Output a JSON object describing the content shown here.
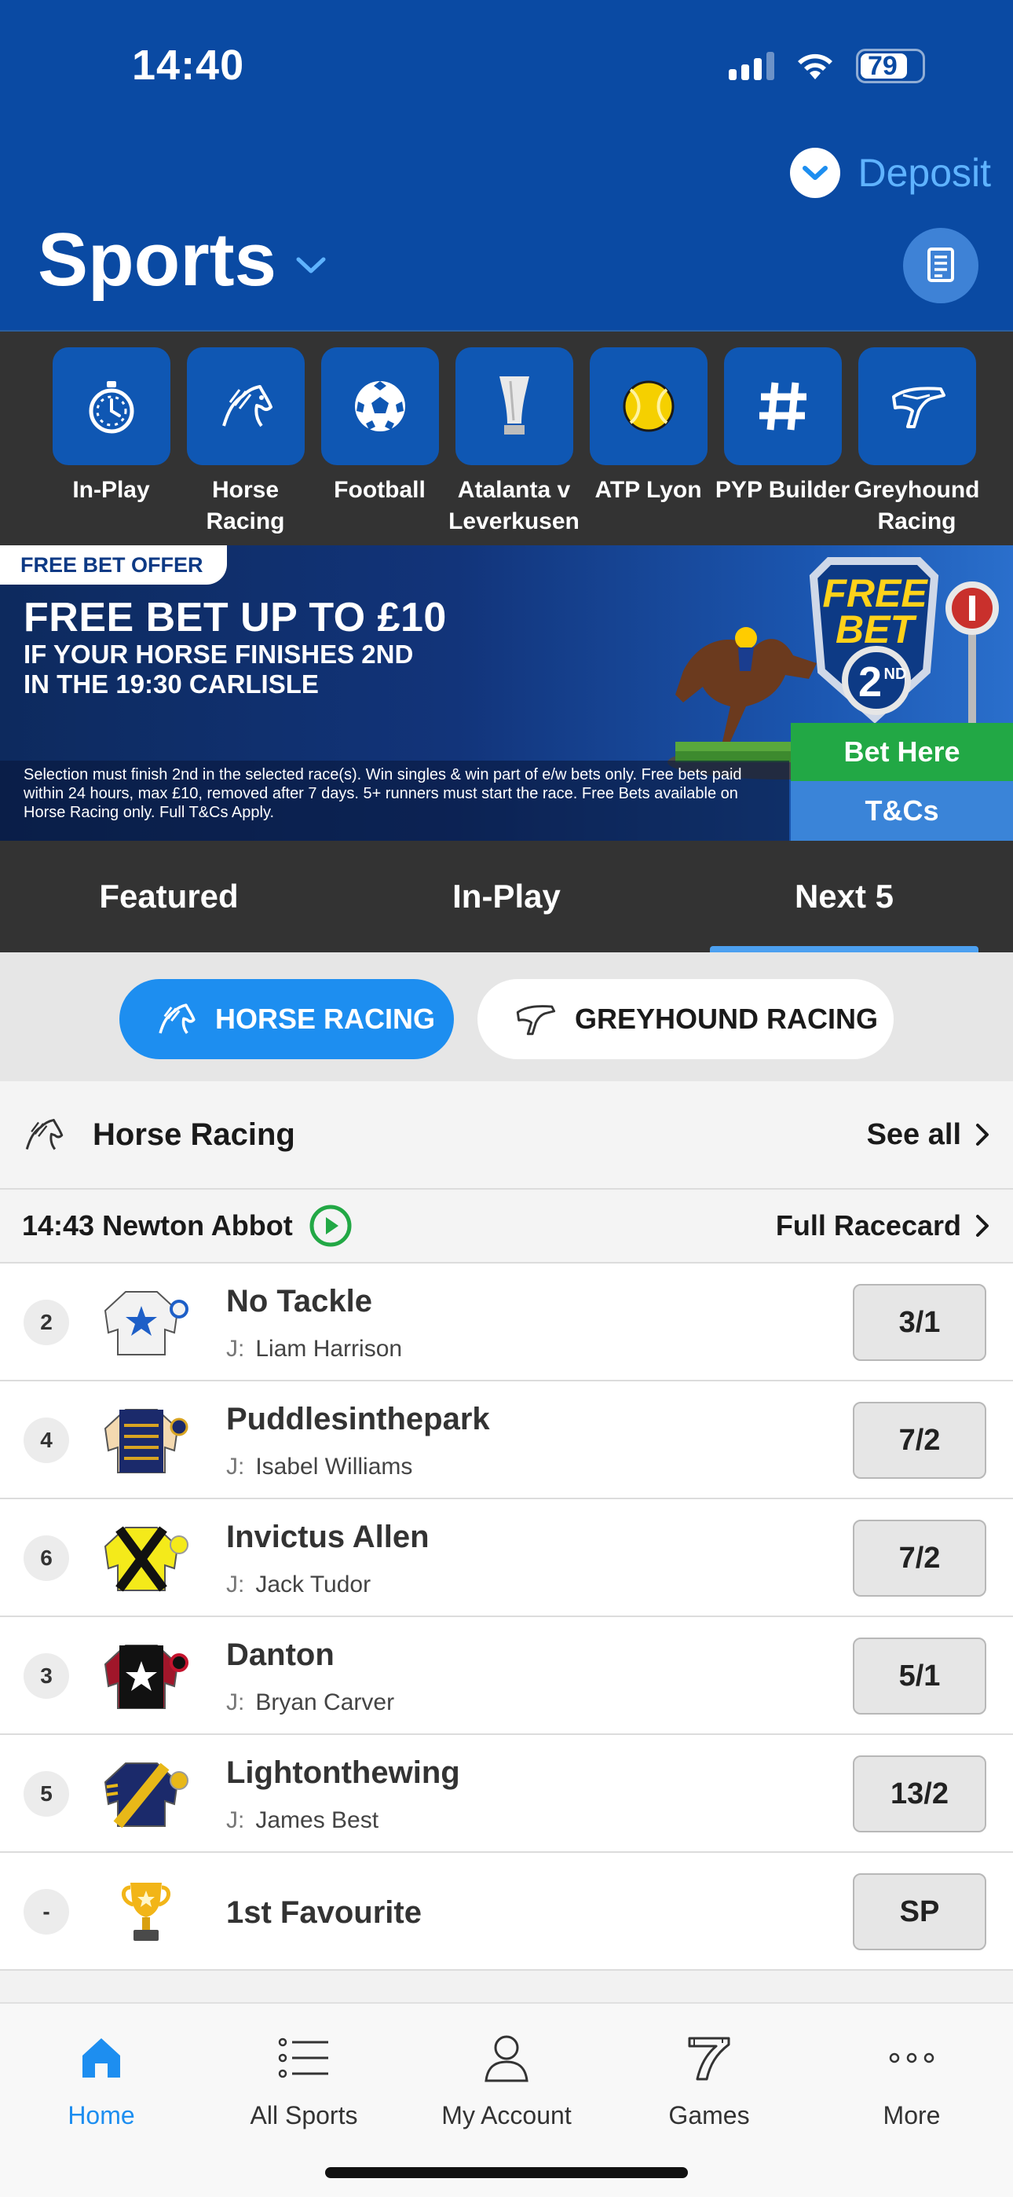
{
  "status_bar": {
    "time": "14:40",
    "battery": "79",
    "battery_level": 0.79
  },
  "header": {
    "deposit_label": "Deposit",
    "title": "Sports"
  },
  "quick_links": [
    {
      "label_1": "In-Play",
      "label_2": "",
      "icon": "stopwatch-icon"
    },
    {
      "label_1": "Horse",
      "label_2": "Racing",
      "icon": "horse-head-icon"
    },
    {
      "label_1": "Football",
      "label_2": "",
      "icon": "football-icon"
    },
    {
      "label_1": "Atalanta v",
      "label_2": "Leverkusen",
      "icon": "trophy-icon"
    },
    {
      "label_1": "ATP Lyon",
      "label_2": "",
      "icon": "tennis-ball-icon"
    },
    {
      "label_1": "PYP Builder",
      "label_2": "",
      "icon": "hash-icon"
    },
    {
      "label_1": "Greyhound",
      "label_2": "Racing",
      "icon": "greyhound-icon"
    }
  ],
  "promo": {
    "tag": "FREE BET OFFER",
    "headline": "FREE BET UP TO £10",
    "sub_line_1": "IF YOUR HORSE FINISHES 2ND",
    "sub_line_2": "IN THE 19:30 CARLISLE",
    "terms": "Selection must finish 2nd in the selected race(s). Win singles & win part of e/w bets only. Free bets paid within 24 hours, max £10, removed after 7 days. 5+ runners must start the race. Free Bets available on Horse Racing only. Full T&Cs Apply.",
    "badge_line_1": "FREE",
    "badge_line_2": "BET",
    "badge_place": "2",
    "badge_suffix": "ND",
    "bet_here_label": "Bet Here",
    "tcs_label": "T&Cs"
  },
  "tabs": [
    {
      "label": "Featured",
      "active": false
    },
    {
      "label": "In-Play",
      "active": false
    },
    {
      "label": "Next 5",
      "active": true
    }
  ],
  "sport_toggle": {
    "horse": "HORSE RACING",
    "greyhound": "GREYHOUND RACING"
  },
  "section": {
    "title": "Horse Racing",
    "see_all": "See all"
  },
  "race": {
    "title": "14:43 Newton Abbot",
    "racecard_label": "Full Racecard"
  },
  "runners": [
    {
      "num": "2",
      "name": "No Tackle",
      "jockey_label": "J:",
      "jockey": "Liam Harrison",
      "odds": "3/1",
      "silk": "white-blue-star"
    },
    {
      "num": "4",
      "name": "Puddlesinthepark",
      "jockey_label": "J:",
      "jockey": "Isabel Williams",
      "odds": "7/2",
      "silk": "navy-gold-braid"
    },
    {
      "num": "6",
      "name": "Invictus Allen",
      "jockey_label": "J:",
      "jockey": "Jack Tudor",
      "odds": "7/2",
      "silk": "yellow-black-cross"
    },
    {
      "num": "3",
      "name": "Danton",
      "jockey_label": "J:",
      "jockey": "Bryan Carver",
      "odds": "5/1",
      "silk": "black-white-star"
    },
    {
      "num": "5",
      "name": "Lightonthewing",
      "jockey_label": "J:",
      "jockey": "James Best",
      "odds": "13/2",
      "silk": "navy-yellow-sash"
    },
    {
      "num": "-",
      "name": "1st Favourite",
      "odds": "SP",
      "silk": "trophy"
    }
  ],
  "bottom_nav": [
    {
      "label": "Home",
      "icon": "home-icon",
      "active": true
    },
    {
      "label": "All Sports",
      "icon": "list-icon",
      "active": false
    },
    {
      "label": "My Account",
      "icon": "person-icon",
      "active": false
    },
    {
      "label": "Games",
      "icon": "slot-seven-icon",
      "active": false
    },
    {
      "label": "More",
      "icon": "more-dots-icon",
      "active": false
    }
  ],
  "colors": {
    "brand_blue": "#0a4aa3",
    "accent_blue": "#1d8ef0",
    "dark_bar": "#333333",
    "bet_green": "#22a845"
  }
}
